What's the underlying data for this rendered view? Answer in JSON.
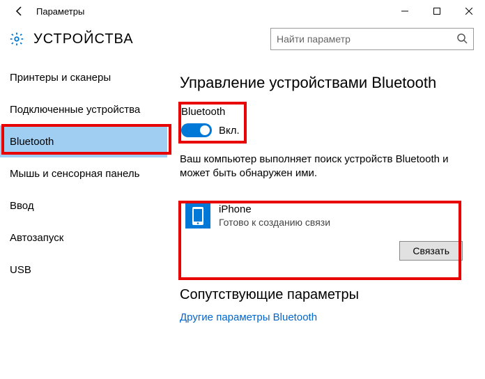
{
  "titlebar": {
    "title": "Параметры"
  },
  "header": {
    "page_title": "УСТРОЙСТВА",
    "search_placeholder": "Найти параметр"
  },
  "sidebar": {
    "items": [
      {
        "label": "Принтеры и сканеры",
        "selected": false
      },
      {
        "label": "Подключенные устройства",
        "selected": false
      },
      {
        "label": "Bluetooth",
        "selected": true
      },
      {
        "label": "Мышь и сенсорная панель",
        "selected": false
      },
      {
        "label": "Ввод",
        "selected": false
      },
      {
        "label": "Автозапуск",
        "selected": false
      },
      {
        "label": "USB",
        "selected": false
      }
    ]
  },
  "content": {
    "heading": "Управление устройствами Bluetooth",
    "toggle": {
      "label": "Bluetooth",
      "state": "Вкл.",
      "on": true
    },
    "description": "Ваш компьютер выполняет поиск устройств Bluetooth и может быть обнаружен ими.",
    "device": {
      "name": "iPhone",
      "status": "Готово к созданию связи",
      "action": "Связать"
    },
    "related_heading": "Сопутствующие параметры",
    "related_link": "Другие параметры Bluetooth"
  }
}
